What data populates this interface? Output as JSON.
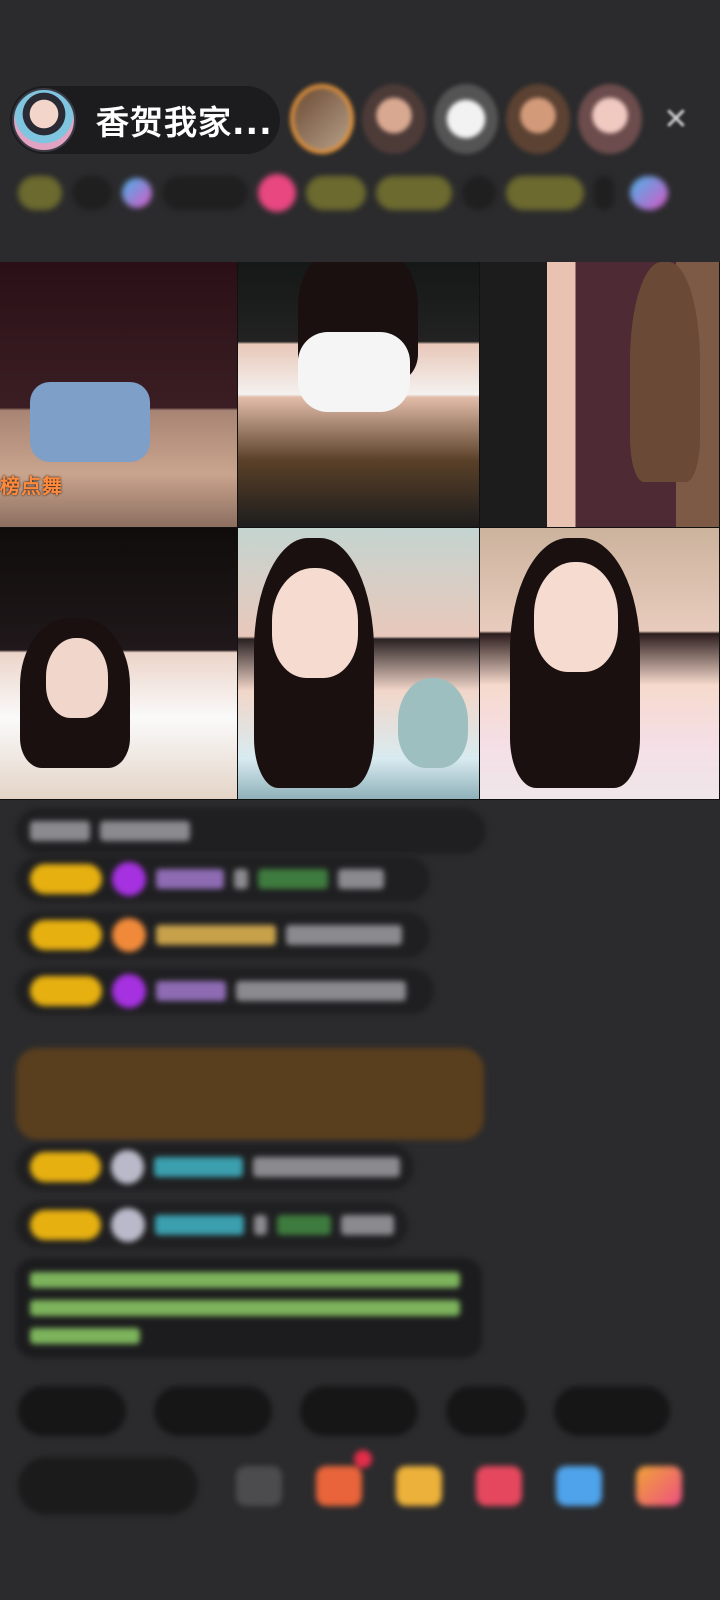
{
  "header": {
    "host_name": "香贺我家...",
    "close_icon": "close-icon",
    "viewer_avatars": [
      "viewer-avatar-1",
      "viewer-avatar-2",
      "viewer-avatar-3",
      "viewer-avatar-4",
      "viewer-avatar-5"
    ]
  },
  "video_grid": {
    "tiles": [
      {
        "label": "榜点舞"
      },
      {
        "label": ""
      },
      {
        "label": ""
      },
      {
        "label": ""
      },
      {
        "label": ""
      },
      {
        "label": ""
      }
    ]
  },
  "colors": {
    "background": "#2b2b2d",
    "level_badge": "#e6b010",
    "tile_label": "#ff8a3c",
    "highlight_message": "#5a3f1e"
  }
}
